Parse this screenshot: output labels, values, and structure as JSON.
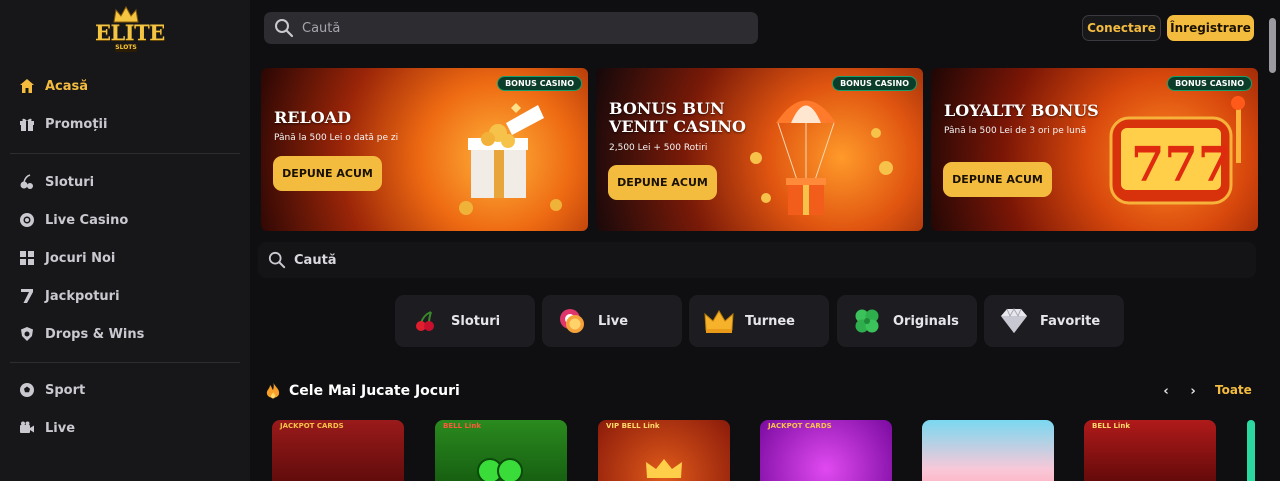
{
  "sidebar": {
    "logo": {
      "word": "ELITE",
      "sub": "SLOTS"
    },
    "items": [
      {
        "label": "Acasă",
        "icon": "home-icon",
        "active": true
      },
      {
        "label": "Promoții",
        "icon": "gift-icon"
      },
      {
        "label": "Sloturi",
        "icon": "slot-icon"
      },
      {
        "label": "Live Casino",
        "icon": "chip-icon"
      },
      {
        "label": "Jocuri Noi",
        "icon": "grid-icon"
      },
      {
        "label": "Jackpoturi",
        "icon": "seven-icon"
      },
      {
        "label": "Drops & Wins",
        "icon": "shield-icon"
      },
      {
        "label": "Sport",
        "icon": "football-icon"
      },
      {
        "label": "Live",
        "icon": "camera-icon"
      }
    ]
  },
  "header": {
    "search_placeholder": "Caută",
    "login_label": "Conectare",
    "register_label": "Înregistrare"
  },
  "banners": [
    {
      "badge": "BONUS CASINO",
      "title": "RELOAD",
      "subtitle": "Până la 500 Lei o dată pe zi",
      "cta": "DEPUNE ACUM"
    },
    {
      "badge": "BONUS CASINO",
      "title": "BONUS BUN VENIT CASINO",
      "subtitle": "2,500 Lei + 500 Rotiri",
      "cta": "DEPUNE ACUM"
    },
    {
      "badge": "BONUS CASINO",
      "title": "LOYALTY BONUS",
      "subtitle": "Până la 500 Lei de 3 ori pe lună",
      "cta": "DEPUNE ACUM"
    }
  ],
  "game_search": {
    "placeholder": "Caută"
  },
  "categories": [
    {
      "label": "Sloturi",
      "icon": "cherry-icon"
    },
    {
      "label": "Live",
      "icon": "chip-icon"
    },
    {
      "label": "Turnee",
      "icon": "crown-icon"
    },
    {
      "label": "Originals",
      "icon": "clover-icon"
    },
    {
      "label": "Favorite",
      "icon": "diamond-icon"
    }
  ],
  "section": {
    "title": "Cele Mai Jucate Jocuri",
    "see_all": "Toate"
  },
  "games": [
    {
      "logo": "JACKPOT CARDS"
    },
    {
      "logo": "BELL Link"
    },
    {
      "logo": "VIP BELL Link"
    },
    {
      "logo": "JACKPOT CARDS"
    },
    {
      "logo": ""
    },
    {
      "logo": "BELL Link"
    }
  ],
  "colors": {
    "accent": "#f3bc3f",
    "sidebar_bg": "#17171a",
    "page_bg": "#0f0f11",
    "badge_green": "#17a06b"
  }
}
